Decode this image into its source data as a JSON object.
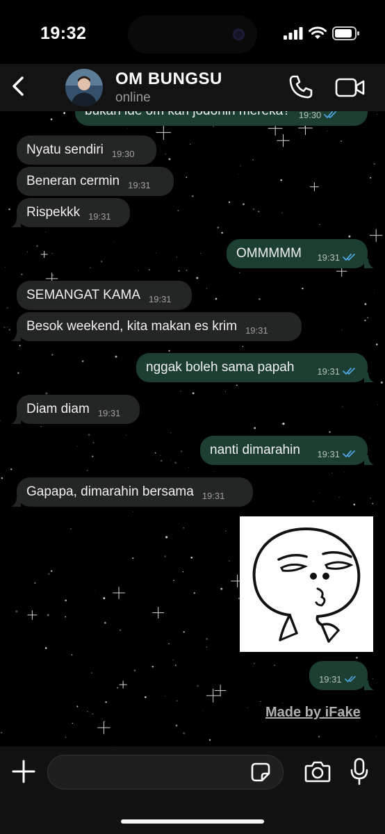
{
  "status_bar": {
    "time": "19:32"
  },
  "header": {
    "contact_name": "OM BUNGSU",
    "contact_status": "online"
  },
  "messages": [
    {
      "dir": "out",
      "text": "bukan ide om kan jodohin mereka?",
      "time": "19:30",
      "read": true,
      "partial": true
    },
    {
      "dir": "in",
      "text": "Nyatu sendiri",
      "time": "19:30"
    },
    {
      "dir": "in",
      "text": "Beneran cermin",
      "time": "19:31"
    },
    {
      "dir": "in",
      "text": "Rispekkk",
      "time": "19:31"
    },
    {
      "dir": "out",
      "text": "OMMMMM",
      "time": "19:31",
      "read": true
    },
    {
      "dir": "in",
      "text": "SEMANGAT KAMA",
      "time": "19:31"
    },
    {
      "dir": "in",
      "text": "Besok weekend, kita makan es krim",
      "time": "19:31"
    },
    {
      "dir": "out",
      "text": "nggak boleh sama papah",
      "time": "19:31",
      "read": true
    },
    {
      "dir": "in",
      "text": "Diam diam",
      "time": "19:31"
    },
    {
      "dir": "out",
      "text": "nanti dimarahin",
      "time": "19:31",
      "read": true
    },
    {
      "dir": "in",
      "text": "Gapapa, dimarahin bersama",
      "time": "19:31"
    },
    {
      "dir": "out",
      "text": "",
      "time": "19:31",
      "read": true,
      "sticker": true
    }
  ],
  "watermark": "Made by iFake",
  "composer": {
    "placeholder": ""
  },
  "colors": {
    "incoming_bubble": "#242626",
    "outgoing_bubble": "#1d3f31",
    "read_ticks": "#4fa3e0"
  },
  "icons": [
    "back-icon",
    "phone-icon",
    "video-icon",
    "plus-icon",
    "sticker-icon",
    "camera-icon",
    "mic-icon"
  ]
}
